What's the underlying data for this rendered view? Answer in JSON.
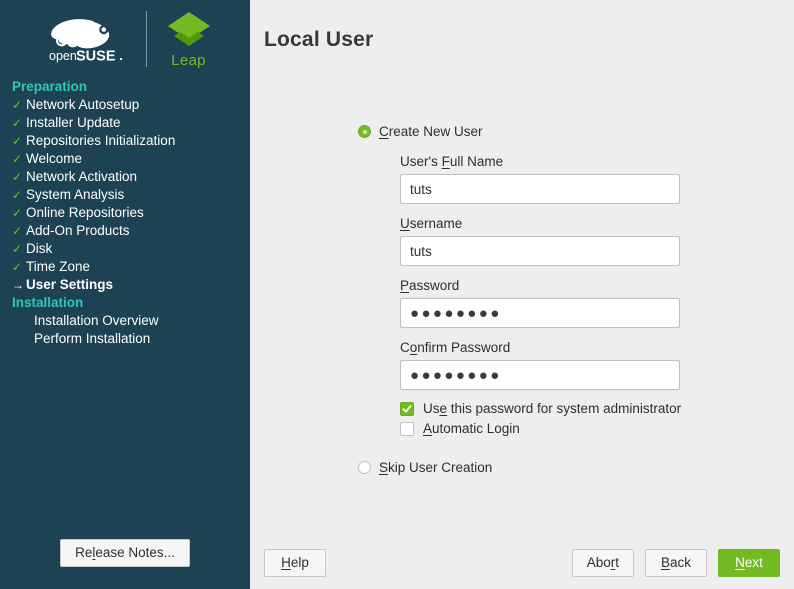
{
  "sidebar": {
    "brand": {
      "suse_open": "open",
      "suse_bold": "SUSE",
      "product": "Leap",
      "logo_icon": "chameleon-logo",
      "product_icon": "leap-diamond-logo"
    },
    "sections": [
      {
        "header": "Preparation",
        "items": [
          {
            "label": "Network Autosetup",
            "state": "done",
            "mark": "✓"
          },
          {
            "label": "Installer Update",
            "state": "done",
            "mark": "✓"
          },
          {
            "label": "Repositories Initialization",
            "state": "done",
            "mark": "✓"
          },
          {
            "label": "Welcome",
            "state": "done",
            "mark": "✓"
          },
          {
            "label": "Network Activation",
            "state": "done",
            "mark": "✓"
          },
          {
            "label": "System Analysis",
            "state": "done",
            "mark": "✓"
          },
          {
            "label": "Online Repositories",
            "state": "done",
            "mark": "✓"
          },
          {
            "label": "Add-On Products",
            "state": "done",
            "mark": "✓"
          },
          {
            "label": "Disk",
            "state": "done",
            "mark": "✓"
          },
          {
            "label": "Time Zone",
            "state": "done",
            "mark": "✓"
          },
          {
            "label": "User Settings",
            "state": "current",
            "mark": "→"
          }
        ]
      },
      {
        "header": "Installation",
        "items": [
          {
            "label": "Installation Overview",
            "state": "pending",
            "mark": ""
          },
          {
            "label": "Perform Installation",
            "state": "pending",
            "mark": ""
          }
        ]
      }
    ],
    "release_notes": {
      "pre": "Re",
      "mnemonic": "l",
      "post": "ease Notes..."
    }
  },
  "main": {
    "title": "Local User",
    "create_user_radio": {
      "pre": "",
      "mnemonic": "C",
      "post": "reate New User",
      "selected": true
    },
    "skip_user_radio": {
      "pre": "",
      "mnemonic": "S",
      "post": "kip User Creation",
      "selected": false
    },
    "fields": [
      {
        "label_pre": "User's ",
        "label_mnemonic": "F",
        "label_post": "ull Name",
        "value": "tuts",
        "placeholder": "",
        "type": "text",
        "name": "full-name"
      },
      {
        "label_pre": "",
        "label_mnemonic": "U",
        "label_post": "sername",
        "value": "tuts",
        "placeholder": "",
        "type": "text",
        "name": "username"
      },
      {
        "label_pre": "",
        "label_mnemonic": "P",
        "label_post": "assword",
        "value": "●●●●●●●●",
        "placeholder": "",
        "type": "password",
        "name": "password"
      },
      {
        "label_pre": "C",
        "label_mnemonic": "o",
        "label_post": "nfirm Password",
        "value": "●●●●●●●●",
        "placeholder": "",
        "type": "password",
        "name": "confirm-password"
      }
    ],
    "checkboxes": [
      {
        "pre": "Us",
        "mnemonic": "e",
        "post": " this password for system administrator",
        "checked": true,
        "name": "use-password-for-admin"
      },
      {
        "pre": "",
        "mnemonic": "A",
        "post": "utomatic Login",
        "checked": false,
        "name": "automatic-login"
      }
    ]
  },
  "footer": {
    "help": {
      "pre": "",
      "mnemonic": "H",
      "post": "elp"
    },
    "abort": {
      "pre": "Abo",
      "mnemonic": "r",
      "post": "t"
    },
    "back": {
      "pre": "",
      "mnemonic": "B",
      "post": "ack"
    },
    "next": {
      "pre": "",
      "mnemonic": "N",
      "post": "ext"
    }
  },
  "colors": {
    "sidebar_bg": "#1c4254",
    "accent_green": "#73ba25",
    "section_header": "#2fc6b7",
    "content_bg": "#eeeeee",
    "text": "#2e2e2e"
  }
}
